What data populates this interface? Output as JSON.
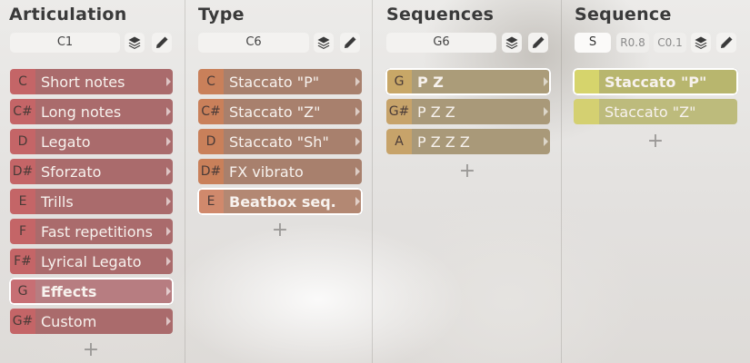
{
  "columns": {
    "articulation": {
      "title": "Articulation",
      "note": "C1",
      "items": [
        {
          "key": "C",
          "label": "Short notes"
        },
        {
          "key": "C#",
          "label": "Long notes"
        },
        {
          "key": "D",
          "label": "Legato"
        },
        {
          "key": "D#",
          "label": "Sforzato"
        },
        {
          "key": "E",
          "label": "Trills"
        },
        {
          "key": "F",
          "label": "Fast repetitions"
        },
        {
          "key": "F#",
          "label": "Lyrical Legato"
        },
        {
          "key": "G",
          "label": "Effects"
        },
        {
          "key": "G#",
          "label": "Custom"
        }
      ],
      "selected_index": 7,
      "add_label": "+"
    },
    "type": {
      "title": "Type",
      "note": "C6",
      "items": [
        {
          "key": "C",
          "label": "Staccato \"P\""
        },
        {
          "key": "C#",
          "label": "Staccato \"Z\""
        },
        {
          "key": "D",
          "label": "Staccato \"Sh\""
        },
        {
          "key": "D#",
          "label": "FX vibrato"
        },
        {
          "key": "E",
          "label": "Beatbox seq."
        }
      ],
      "selected_index": 4,
      "add_label": "+"
    },
    "sequences": {
      "title": "Sequences",
      "note": "G6",
      "items": [
        {
          "key": "G",
          "label": "P Z"
        },
        {
          "key": "G#",
          "label": "P Z Z"
        },
        {
          "key": "A",
          "label": "P Z Z Z"
        }
      ],
      "selected_index": 0,
      "add_label": "+"
    },
    "sequence": {
      "title": "Sequence",
      "s_label": "S",
      "r_label": "R0.8",
      "c_label": "C0.1",
      "items": [
        {
          "label": "Staccato \"P\""
        },
        {
          "label": "Staccato \"Z\""
        }
      ],
      "selected_index": 0,
      "add_label": "+"
    }
  },
  "icons": {
    "layers": "layers-icon",
    "edit": "pencil-icon"
  },
  "colors": {
    "articulation": "#aa6b6c",
    "type": "#a8806d",
    "sequences": "#a99979",
    "sequence": "#bdbb7c"
  }
}
